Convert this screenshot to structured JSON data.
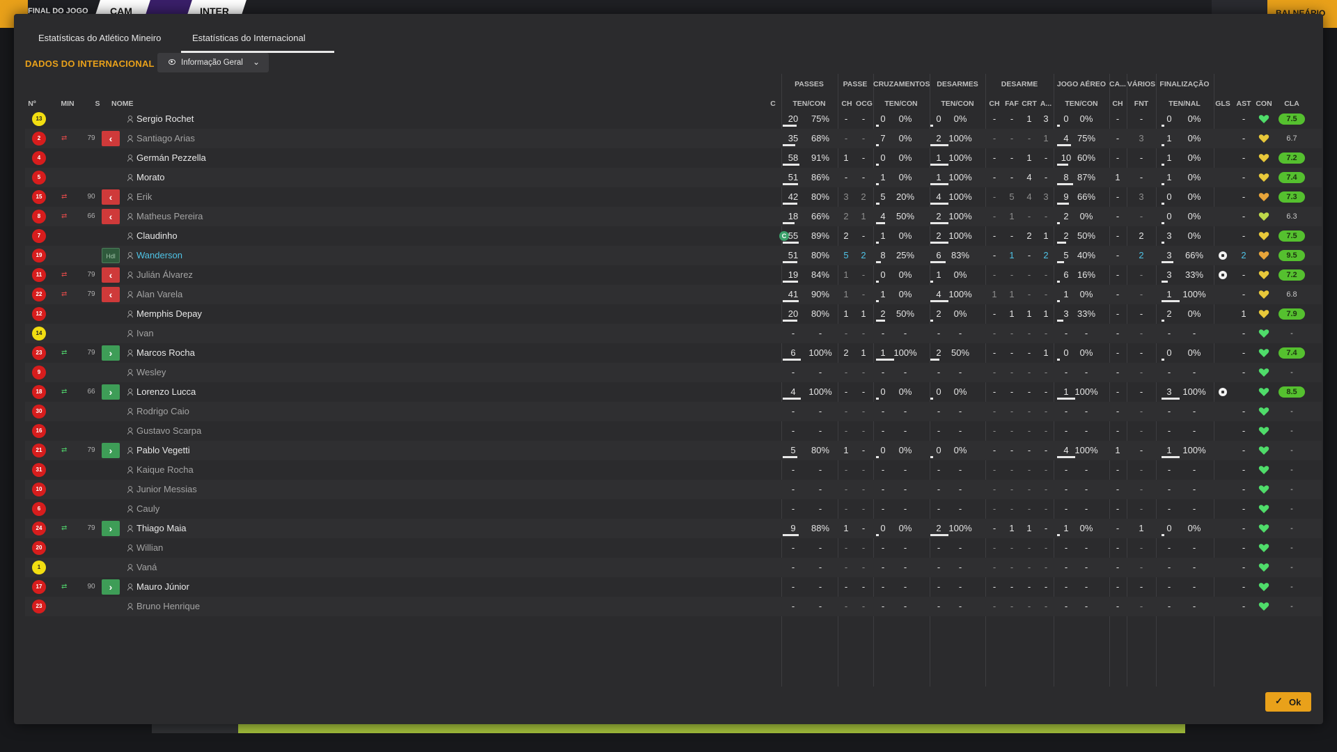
{
  "topbar": {
    "status": "FINAL DO JOGO",
    "home": "CAM",
    "away": "INTER",
    "right_button": "BALNEÁRIO"
  },
  "tabs": [
    {
      "label": "Estatísticas do Atlético Mineiro"
    },
    {
      "label": "Estatísticas do Internacional"
    }
  ],
  "section_title": "DADOS DO INTERNACIONAL",
  "view_select": {
    "label": "Informação Geral"
  },
  "group_headers": {
    "passes": "PASSES",
    "passe": "PASSE",
    "cruzamentos": "CRUZAMENTOS",
    "desarmes": "DESARMES",
    "desarme": "DESARME",
    "jogo_aereo": "JOGO AÉREO",
    "ca": "CA...",
    "varios": "VÁRIOS",
    "finalizacao": "FINALIZAÇÃO"
  },
  "column_headers": {
    "num": "Nº",
    "min": "MIN",
    "s": "S",
    "nome": "NOME",
    "c": "C",
    "passes": "TEN/CON",
    "ch": "CH",
    "ocg": "OCG",
    "cruz": "TEN/CON",
    "des": "TEN/CON",
    "d_ch": "CH",
    "faf": "FAF",
    "crt": "CRT",
    "a": "A...",
    "aereo": "TEN/CON",
    "ca_ch": "CH",
    "fnt": "FNT",
    "fin": "TEN/NAL",
    "gls": "GLS",
    "ast": "AST",
    "con": "CON",
    "cla": "CLA"
  },
  "players": [
    {
      "num": "13",
      "gk": true,
      "sub": "",
      "min": "",
      "sbox": "",
      "name": "Sergio Rochet",
      "style": "",
      "cap": false,
      "p1": "20",
      "p2": "75%",
      "pb": 0.75,
      "pch": "-",
      "pocg": "-",
      "c1": "0",
      "c2": "0%",
      "cb": 0,
      "d1": "0",
      "d2": "0%",
      "db": 0,
      "dch": "-",
      "dfaf": "-",
      "dcrt": "1",
      "da": "3",
      "a1": "0",
      "a2": "0%",
      "ab": 0,
      "cach": "-",
      "fnt": "-",
      "f1": "0",
      "f2": "0%",
      "fb": 0,
      "gls": "",
      "ast": "-",
      "con": "green",
      "cla": "7.5",
      "clag": true
    },
    {
      "num": "2",
      "gk": false,
      "sub": "out",
      "min": "79",
      "sbox": "out",
      "name": "Santiago Arias",
      "style": "unused",
      "cap": false,
      "p1": "35",
      "p2": "68%",
      "pb": 0.68,
      "pch": "-",
      "pocg": "-",
      "c1": "7",
      "c2": "0%",
      "cb": 0,
      "d1": "2",
      "d2": "100%",
      "db": 1,
      "dch": "-",
      "dfaf": "-",
      "dcrt": "-",
      "da": "1",
      "a1": "4",
      "a2": "75%",
      "ab": 0.75,
      "cach": "-",
      "fnt": "3",
      "f1": "1",
      "f2": "0%",
      "fb": 0,
      "gls": "",
      "ast": "-",
      "con": "yellow",
      "cla": "6.7",
      "clag": false
    },
    {
      "num": "4",
      "gk": false,
      "sub": "",
      "min": "",
      "sbox": "",
      "name": "Germán Pezzella",
      "style": "",
      "cap": false,
      "p1": "58",
      "p2": "91%",
      "pb": 0.91,
      "pch": "1",
      "pocg": "-",
      "c1": "0",
      "c2": "0%",
      "cb": 0,
      "d1": "1",
      "d2": "100%",
      "db": 1,
      "dch": "-",
      "dfaf": "-",
      "dcrt": "1",
      "da": "-",
      "a1": "10",
      "a2": "60%",
      "ab": 0.6,
      "cach": "-",
      "fnt": "-",
      "f1": "1",
      "f2": "0%",
      "fb": 0,
      "gls": "",
      "ast": "-",
      "con": "yellow",
      "cla": "7.2",
      "clag": true
    },
    {
      "num": "5",
      "gk": false,
      "sub": "",
      "min": "",
      "sbox": "",
      "name": "Morato",
      "style": "",
      "cap": false,
      "p1": "51",
      "p2": "86%",
      "pb": 0.86,
      "pch": "-",
      "pocg": "-",
      "c1": "1",
      "c2": "0%",
      "cb": 0,
      "d1": "1",
      "d2": "100%",
      "db": 1,
      "dch": "-",
      "dfaf": "-",
      "dcrt": "4",
      "da": "-",
      "a1": "8",
      "a2": "87%",
      "ab": 0.87,
      "cach": "1",
      "fnt": "-",
      "f1": "1",
      "f2": "0%",
      "fb": 0,
      "gls": "",
      "ast": "-",
      "con": "yellow",
      "cla": "7.4",
      "clag": true
    },
    {
      "num": "15",
      "gk": false,
      "sub": "out",
      "min": "90",
      "sbox": "out",
      "name": "Erik",
      "style": "unused",
      "cap": false,
      "p1": "42",
      "p2": "80%",
      "pb": 0.8,
      "pch": "3",
      "pocg": "2",
      "c1": "5",
      "c2": "20%",
      "cb": 0.2,
      "d1": "4",
      "d2": "100%",
      "db": 1,
      "dch": "-",
      "dfaf": "5",
      "dcrt": "4",
      "da": "3",
      "a1": "9",
      "a2": "66%",
      "ab": 0.66,
      "cach": "-",
      "fnt": "3",
      "f1": "0",
      "f2": "0%",
      "fb": 0,
      "gls": "",
      "ast": "-",
      "con": "orange",
      "cla": "7.3",
      "clag": true
    },
    {
      "num": "8",
      "gk": false,
      "sub": "out",
      "min": "66",
      "sbox": "out",
      "name": "Matheus Pereira",
      "style": "unused",
      "cap": false,
      "p1": "18",
      "p2": "66%",
      "pb": 0.66,
      "pch": "2",
      "pocg": "1",
      "c1": "4",
      "c2": "50%",
      "cb": 0.5,
      "d1": "2",
      "d2": "100%",
      "db": 1,
      "dch": "-",
      "dfaf": "1",
      "dcrt": "-",
      "da": "-",
      "a1": "2",
      "a2": "0%",
      "ab": 0,
      "cach": "-",
      "fnt": "-",
      "f1": "0",
      "f2": "0%",
      "fb": 0,
      "gls": "",
      "ast": "-",
      "con": "yellowgreen",
      "cla": "6.3",
      "clag": false
    },
    {
      "num": "7",
      "gk": false,
      "sub": "",
      "min": "",
      "sbox": "",
      "name": "Claudinho",
      "style": "",
      "cap": true,
      "p1": "55",
      "p2": "89%",
      "pb": 0.89,
      "pch": "2",
      "pocg": "-",
      "c1": "1",
      "c2": "0%",
      "cb": 0,
      "d1": "2",
      "d2": "100%",
      "db": 1,
      "dch": "-",
      "dfaf": "-",
      "dcrt": "2",
      "da": "1",
      "a1": "2",
      "a2": "50%",
      "ab": 0.5,
      "cach": "-",
      "fnt": "2",
      "f1": "3",
      "f2": "0%",
      "fb": 0,
      "gls": "",
      "ast": "-",
      "con": "yellow",
      "cla": "7.5",
      "clag": true
    },
    {
      "num": "19",
      "gk": false,
      "sub": "",
      "min": "",
      "sbox": "hdl",
      "name": "Wanderson",
      "style": "star",
      "cap": false,
      "p1": "51",
      "p2": "80%",
      "pb": 0.8,
      "pch": "5",
      "pocg": "2",
      "c1": "8",
      "c2": "25%",
      "cb": 0.25,
      "d1": "6",
      "d2": "83%",
      "db": 0.83,
      "dch": "-",
      "dfaf": "1",
      "dcrt": "-",
      "da": "2",
      "a1": "5",
      "a2": "40%",
      "ab": 0.4,
      "cach": "-",
      "fnt": "2",
      "f1": "3",
      "f2": "66%",
      "fb": 0.66,
      "gls": "ball",
      "ast": "2",
      "con": "orange",
      "cla": "9.5",
      "clag": true
    },
    {
      "num": "11",
      "gk": false,
      "sub": "out",
      "min": "79",
      "sbox": "out",
      "name": "Julián Álvarez",
      "style": "unused",
      "cap": false,
      "p1": "19",
      "p2": "84%",
      "pb": 0.84,
      "pch": "1",
      "pocg": "-",
      "c1": "0",
      "c2": "0%",
      "cb": 0,
      "d1": "1",
      "d2": "0%",
      "db": 0,
      "dch": "-",
      "dfaf": "-",
      "dcrt": "-",
      "da": "-",
      "a1": "6",
      "a2": "16%",
      "ab": 0.16,
      "cach": "-",
      "fnt": "-",
      "f1": "3",
      "f2": "33%",
      "fb": 0.33,
      "gls": "ball",
      "ast": "-",
      "con": "yellow",
      "cla": "7.2",
      "clag": true
    },
    {
      "num": "22",
      "gk": false,
      "sub": "out",
      "min": "79",
      "sbox": "out",
      "name": "Alan Varela",
      "style": "unused",
      "cap": false,
      "p1": "41",
      "p2": "90%",
      "pb": 0.9,
      "pch": "1",
      "pocg": "-",
      "c1": "1",
      "c2": "0%",
      "cb": 0,
      "d1": "4",
      "d2": "100%",
      "db": 1,
      "dch": "1",
      "dfaf": "1",
      "dcrt": "-",
      "da": "-",
      "a1": "1",
      "a2": "0%",
      "ab": 0,
      "cach": "-",
      "fnt": "-",
      "f1": "1",
      "f2": "100%",
      "fb": 1,
      "gls": "",
      "ast": "-",
      "con": "yellow",
      "cla": "6.8",
      "clag": false
    },
    {
      "num": "12",
      "gk": false,
      "sub": "",
      "min": "",
      "sbox": "",
      "name": "Memphis Depay",
      "style": "",
      "cap": false,
      "p1": "20",
      "p2": "80%",
      "pb": 0.8,
      "pch": "1",
      "pocg": "1",
      "c1": "2",
      "c2": "50%",
      "cb": 0.5,
      "d1": "2",
      "d2": "0%",
      "db": 0,
      "dch": "-",
      "dfaf": "1",
      "dcrt": "1",
      "da": "1",
      "a1": "3",
      "a2": "33%",
      "ab": 0.33,
      "cach": "-",
      "fnt": "-",
      "f1": "2",
      "f2": "0%",
      "fb": 0,
      "gls": "",
      "ast": "1",
      "con": "yellow",
      "cla": "7.9",
      "clag": true
    },
    {
      "num": "14",
      "gk": true,
      "sub": "",
      "min": "",
      "sbox": "",
      "name": "Ivan",
      "style": "unused",
      "cap": false,
      "p1": "-",
      "p2": "-",
      "pb": -1,
      "pch": "-",
      "pocg": "-",
      "c1": "-",
      "c2": "-",
      "cb": -1,
      "d1": "-",
      "d2": "-",
      "db": -1,
      "dch": "-",
      "dfaf": "-",
      "dcrt": "-",
      "da": "-",
      "a1": "-",
      "a2": "-",
      "ab": -1,
      "cach": "-",
      "fnt": "-",
      "f1": "-",
      "f2": "-",
      "fb": -1,
      "gls": "",
      "ast": "-",
      "con": "green",
      "cla": "-",
      "clag": false
    },
    {
      "num": "23",
      "gk": false,
      "sub": "in",
      "min": "79",
      "sbox": "in",
      "name": "Marcos Rocha",
      "style": "",
      "cap": false,
      "p1": "6",
      "p2": "100%",
      "pb": 1,
      "pch": "2",
      "pocg": "1",
      "c1": "1",
      "c2": "100%",
      "cb": 1,
      "d1": "2",
      "d2": "50%",
      "db": 0.5,
      "dch": "-",
      "dfaf": "-",
      "dcrt": "-",
      "da": "1",
      "a1": "0",
      "a2": "0%",
      "ab": 0,
      "cach": "-",
      "fnt": "-",
      "f1": "0",
      "f2": "0%",
      "fb": 0,
      "gls": "",
      "ast": "-",
      "con": "green",
      "cla": "7.4",
      "clag": true
    },
    {
      "num": "9",
      "gk": false,
      "sub": "",
      "min": "",
      "sbox": "",
      "name": "Wesley",
      "style": "unused",
      "cap": false,
      "p1": "-",
      "p2": "-",
      "pb": -1,
      "pch": "-",
      "pocg": "-",
      "c1": "-",
      "c2": "-",
      "cb": -1,
      "d1": "-",
      "d2": "-",
      "db": -1,
      "dch": "-",
      "dfaf": "-",
      "dcrt": "-",
      "da": "-",
      "a1": "-",
      "a2": "-",
      "ab": -1,
      "cach": "-",
      "fnt": "-",
      "f1": "-",
      "f2": "-",
      "fb": -1,
      "gls": "",
      "ast": "-",
      "con": "green",
      "cla": "-",
      "clag": false
    },
    {
      "num": "18",
      "gk": false,
      "sub": "in",
      "min": "66",
      "sbox": "in",
      "name": "Lorenzo Lucca",
      "style": "",
      "cap": false,
      "p1": "4",
      "p2": "100%",
      "pb": 1,
      "pch": "-",
      "pocg": "-",
      "c1": "0",
      "c2": "0%",
      "cb": 0,
      "d1": "0",
      "d2": "0%",
      "db": 0,
      "dch": "-",
      "dfaf": "-",
      "dcrt": "-",
      "da": "-",
      "a1": "1",
      "a2": "100%",
      "ab": 1,
      "cach": "-",
      "fnt": "-",
      "f1": "3",
      "f2": "100%",
      "fb": 1,
      "gls": "ball2",
      "ast": "",
      "con": "green",
      "cla": "8.5",
      "clag": true
    },
    {
      "num": "30",
      "gk": false,
      "sub": "",
      "min": "",
      "sbox": "",
      "name": "Rodrigo Caio",
      "style": "unused",
      "cap": false,
      "p1": "-",
      "p2": "-",
      "pb": -1,
      "pch": "-",
      "pocg": "-",
      "c1": "-",
      "c2": "-",
      "cb": -1,
      "d1": "-",
      "d2": "-",
      "db": -1,
      "dch": "-",
      "dfaf": "-",
      "dcrt": "-",
      "da": "-",
      "a1": "-",
      "a2": "-",
      "ab": -1,
      "cach": "-",
      "fnt": "-",
      "f1": "-",
      "f2": "-",
      "fb": -1,
      "gls": "",
      "ast": "-",
      "con": "green",
      "cla": "-",
      "clag": false
    },
    {
      "num": "16",
      "gk": false,
      "sub": "",
      "min": "",
      "sbox": "",
      "name": "Gustavo Scarpa",
      "style": "unused",
      "cap": false,
      "p1": "-",
      "p2": "-",
      "pb": -1,
      "pch": "-",
      "pocg": "-",
      "c1": "-",
      "c2": "-",
      "cb": -1,
      "d1": "-",
      "d2": "-",
      "db": -1,
      "dch": "-",
      "dfaf": "-",
      "dcrt": "-",
      "da": "-",
      "a1": "-",
      "a2": "-",
      "ab": -1,
      "cach": "-",
      "fnt": "-",
      "f1": "-",
      "f2": "-",
      "fb": -1,
      "gls": "",
      "ast": "-",
      "con": "green",
      "cla": "-",
      "clag": false
    },
    {
      "num": "21",
      "gk": false,
      "sub": "in",
      "min": "79",
      "sbox": "in",
      "name": "Pablo Vegetti",
      "style": "",
      "cap": false,
      "p1": "5",
      "p2": "80%",
      "pb": 0.8,
      "pch": "1",
      "pocg": "-",
      "c1": "0",
      "c2": "0%",
      "cb": 0,
      "d1": "0",
      "d2": "0%",
      "db": 0,
      "dch": "-",
      "dfaf": "-",
      "dcrt": "-",
      "da": "-",
      "a1": "4",
      "a2": "100%",
      "ab": 1,
      "cach": "1",
      "fnt": "-",
      "f1": "1",
      "f2": "100%",
      "fb": 1,
      "gls": "",
      "ast": "-",
      "con": "green",
      "cla": "-",
      "clag": false
    },
    {
      "num": "31",
      "gk": false,
      "sub": "",
      "min": "",
      "sbox": "",
      "name": "Kaique Rocha",
      "style": "unused",
      "cap": false,
      "p1": "-",
      "p2": "-",
      "pb": -1,
      "pch": "-",
      "pocg": "-",
      "c1": "-",
      "c2": "-",
      "cb": -1,
      "d1": "-",
      "d2": "-",
      "db": -1,
      "dch": "-",
      "dfaf": "-",
      "dcrt": "-",
      "da": "-",
      "a1": "-",
      "a2": "-",
      "ab": -1,
      "cach": "-",
      "fnt": "-",
      "f1": "-",
      "f2": "-",
      "fb": -1,
      "gls": "",
      "ast": "-",
      "con": "green",
      "cla": "-",
      "clag": false
    },
    {
      "num": "10",
      "gk": false,
      "sub": "",
      "min": "",
      "sbox": "",
      "name": "Junior Messias",
      "style": "unused",
      "cap": false,
      "p1": "-",
      "p2": "-",
      "pb": -1,
      "pch": "-",
      "pocg": "-",
      "c1": "-",
      "c2": "-",
      "cb": -1,
      "d1": "-",
      "d2": "-",
      "db": -1,
      "dch": "-",
      "dfaf": "-",
      "dcrt": "-",
      "da": "-",
      "a1": "-",
      "a2": "-",
      "ab": -1,
      "cach": "-",
      "fnt": "-",
      "f1": "-",
      "f2": "-",
      "fb": -1,
      "gls": "",
      "ast": "-",
      "con": "green",
      "cla": "-",
      "clag": false
    },
    {
      "num": "6",
      "gk": false,
      "sub": "",
      "min": "",
      "sbox": "",
      "name": "Cauly",
      "style": "unused",
      "cap": false,
      "p1": "-",
      "p2": "-",
      "pb": -1,
      "pch": "-",
      "pocg": "-",
      "c1": "-",
      "c2": "-",
      "cb": -1,
      "d1": "-",
      "d2": "-",
      "db": -1,
      "dch": "-",
      "dfaf": "-",
      "dcrt": "-",
      "da": "-",
      "a1": "-",
      "a2": "-",
      "ab": -1,
      "cach": "-",
      "fnt": "-",
      "f1": "-",
      "f2": "-",
      "fb": -1,
      "gls": "",
      "ast": "-",
      "con": "green",
      "cla": "-",
      "clag": false
    },
    {
      "num": "24",
      "gk": false,
      "sub": "in",
      "min": "79",
      "sbox": "in",
      "name": "Thiago Maia",
      "style": "",
      "cap": false,
      "p1": "9",
      "p2": "88%",
      "pb": 0.88,
      "pch": "1",
      "pocg": "-",
      "c1": "0",
      "c2": "0%",
      "cb": 0,
      "d1": "2",
      "d2": "100%",
      "db": 1,
      "dch": "-",
      "dfaf": "1",
      "dcrt": "1",
      "da": "-",
      "a1": "1",
      "a2": "0%",
      "ab": 0,
      "cach": "-",
      "fnt": "1",
      "f1": "0",
      "f2": "0%",
      "fb": 0,
      "gls": "",
      "ast": "-",
      "con": "green",
      "cla": "-",
      "clag": false
    },
    {
      "num": "20",
      "gk": false,
      "sub": "",
      "min": "",
      "sbox": "",
      "name": "Willian",
      "style": "unused",
      "cap": false,
      "p1": "-",
      "p2": "-",
      "pb": -1,
      "pch": "-",
      "pocg": "-",
      "c1": "-",
      "c2": "-",
      "cb": -1,
      "d1": "-",
      "d2": "-",
      "db": -1,
      "dch": "-",
      "dfaf": "-",
      "dcrt": "-",
      "da": "-",
      "a1": "-",
      "a2": "-",
      "ab": -1,
      "cach": "-",
      "fnt": "-",
      "f1": "-",
      "f2": "-",
      "fb": -1,
      "gls": "",
      "ast": "-",
      "con": "green",
      "cla": "-",
      "clag": false
    },
    {
      "num": "1",
      "gk": true,
      "sub": "",
      "min": "",
      "sbox": "",
      "name": "Vaná",
      "style": "unused",
      "cap": false,
      "p1": "-",
      "p2": "-",
      "pb": -1,
      "pch": "-",
      "pocg": "-",
      "c1": "-",
      "c2": "-",
      "cb": -1,
      "d1": "-",
      "d2": "-",
      "db": -1,
      "dch": "-",
      "dfaf": "-",
      "dcrt": "-",
      "da": "-",
      "a1": "-",
      "a2": "-",
      "ab": -1,
      "cach": "-",
      "fnt": "-",
      "f1": "-",
      "f2": "-",
      "fb": -1,
      "gls": "",
      "ast": "-",
      "con": "green",
      "cla": "-",
      "clag": false
    },
    {
      "num": "17",
      "gk": false,
      "sub": "in",
      "min": "90",
      "sbox": "in",
      "name": "Mauro Júnior",
      "style": "",
      "cap": false,
      "p1": "-",
      "p2": "-",
      "pb": -1,
      "pch": "-",
      "pocg": "-",
      "c1": "-",
      "c2": "-",
      "cb": -1,
      "d1": "-",
      "d2": "-",
      "db": -1,
      "dch": "-",
      "dfaf": "-",
      "dcrt": "-",
      "da": "-",
      "a1": "-",
      "a2": "-",
      "ab": -1,
      "cach": "-",
      "fnt": "-",
      "f1": "-",
      "f2": "-",
      "fb": -1,
      "gls": "",
      "ast": "-",
      "con": "green",
      "cla": "-",
      "clag": false
    },
    {
      "num": "23",
      "gk": false,
      "sub": "",
      "min": "",
      "sbox": "",
      "name": "Bruno Henrique",
      "style": "unused",
      "cap": false,
      "p1": "-",
      "p2": "-",
      "pb": -1,
      "pch": "-",
      "pocg": "-",
      "c1": "-",
      "c2": "-",
      "cb": -1,
      "d1": "-",
      "d2": "-",
      "db": -1,
      "dch": "-",
      "dfaf": "-",
      "dcrt": "-",
      "da": "-",
      "a1": "-",
      "a2": "-",
      "ab": -1,
      "cach": "-",
      "fnt": "-",
      "f1": "-",
      "f2": "-",
      "fb": -1,
      "gls": "",
      "ast": "-",
      "con": "green",
      "cla": "-",
      "clag": false
    }
  ],
  "substitution_box": {
    "hdl": "Hdl"
  },
  "ok_button": {
    "label": "Ok"
  },
  "colors": {
    "accent": "#e9a11a",
    "rating_green": "#55c02f",
    "sub_out": "#cf3a3a",
    "sub_in": "#3e9d57",
    "cyan": "#4fc3e6"
  }
}
